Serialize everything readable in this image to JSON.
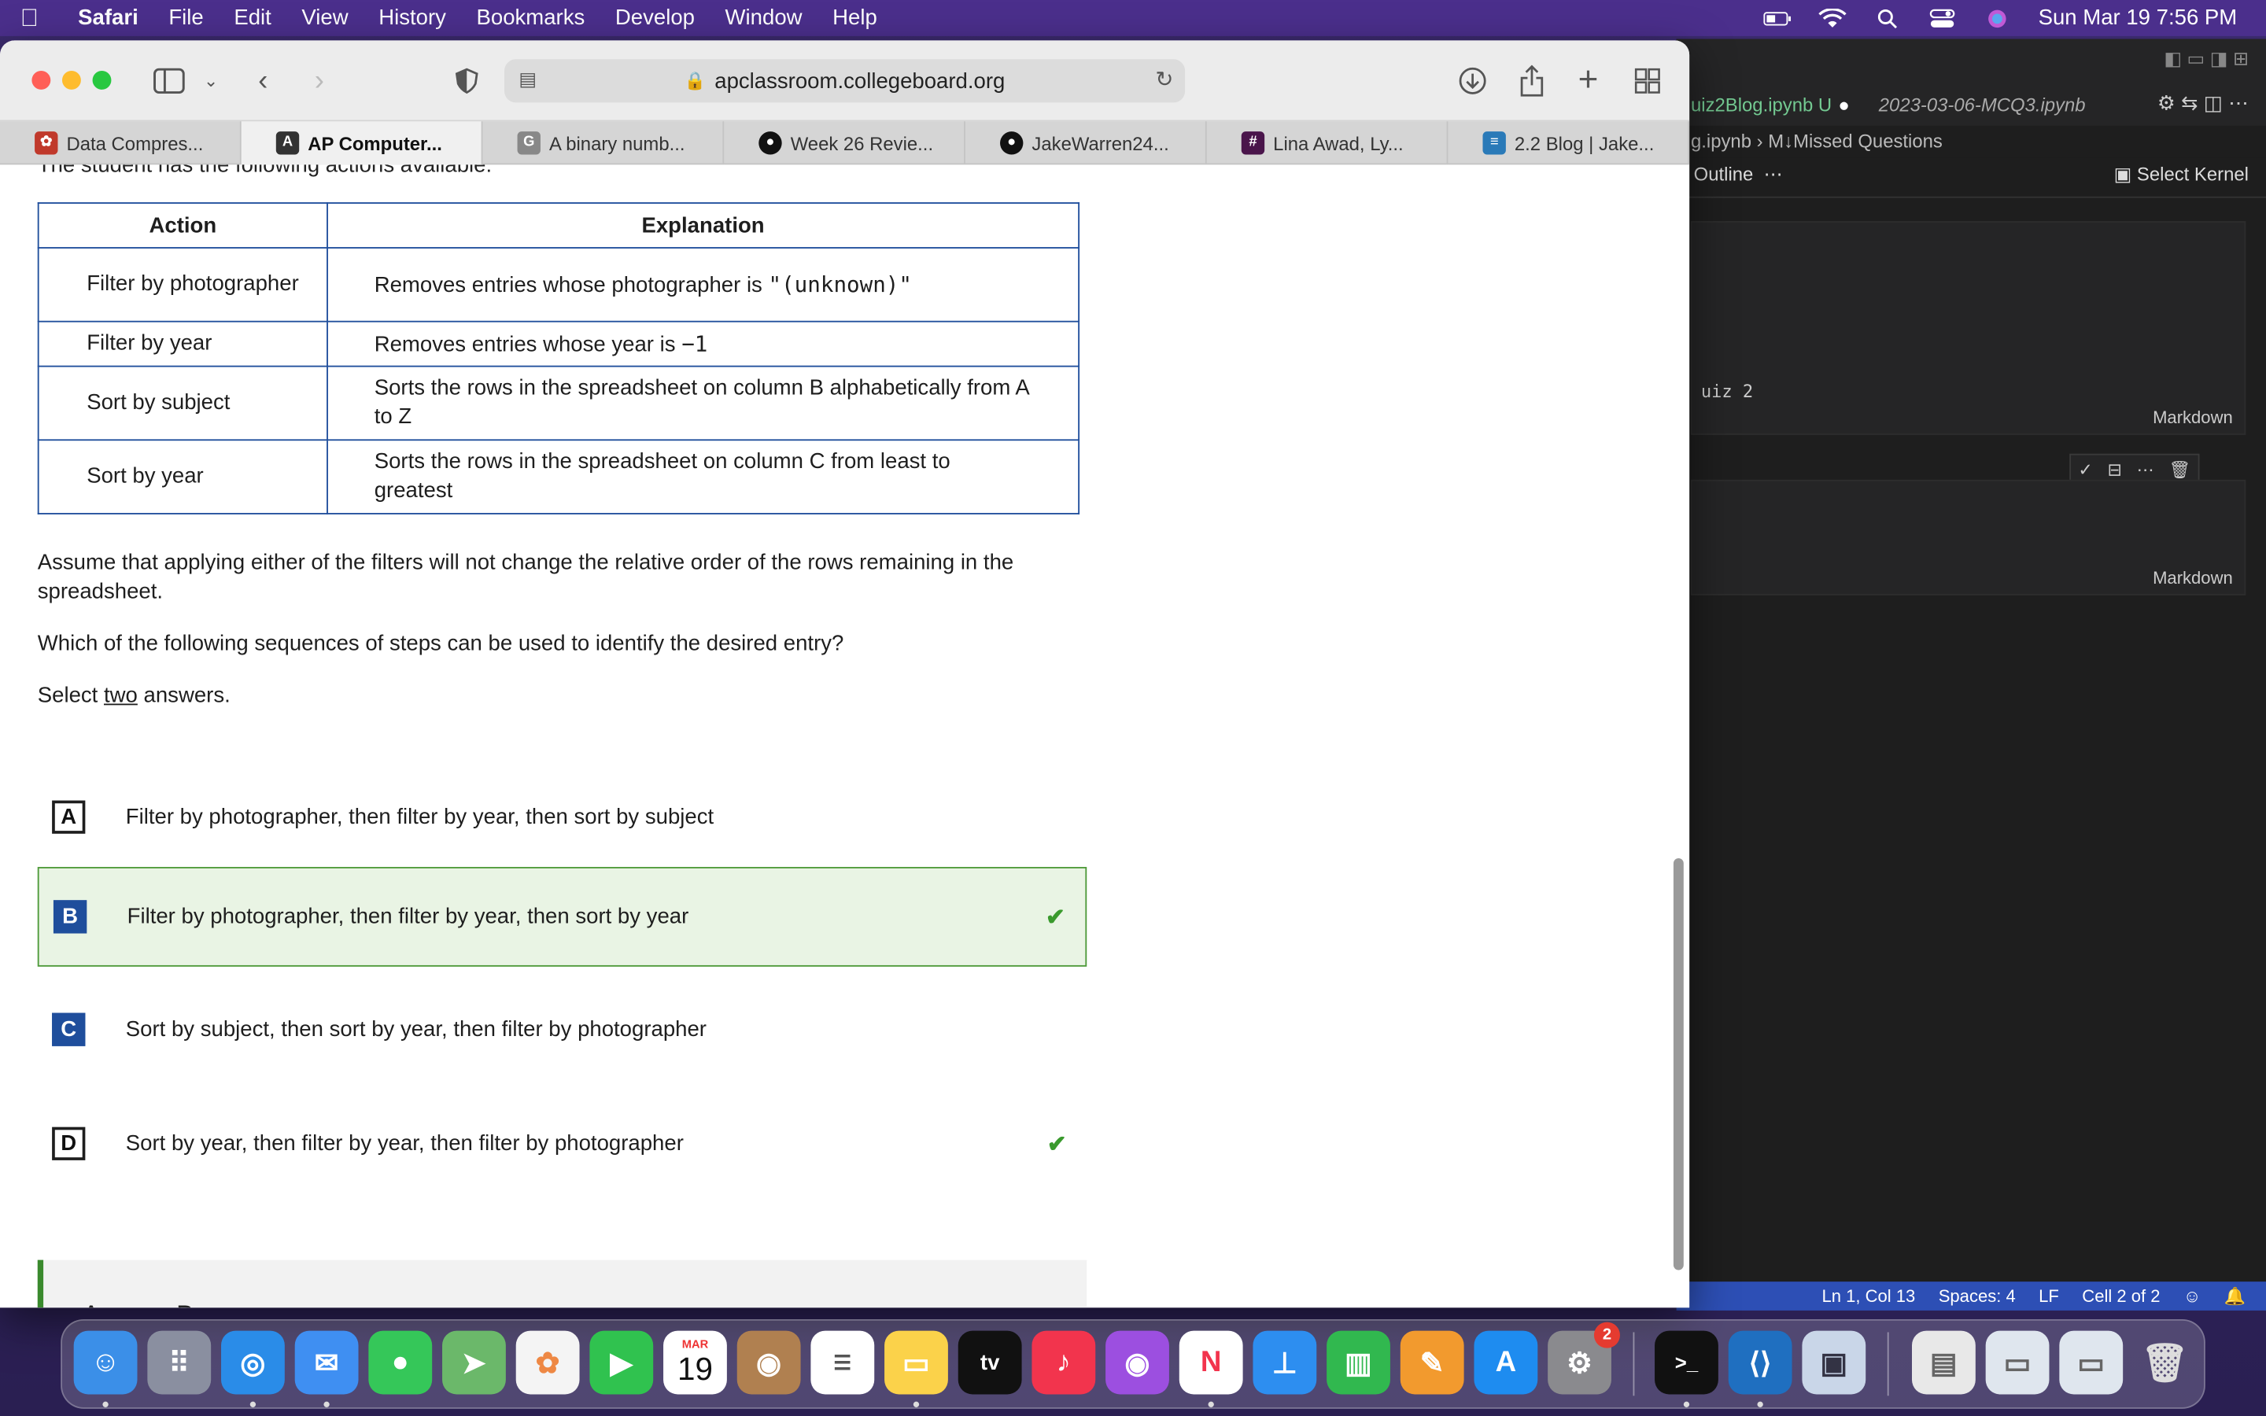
{
  "menubar": {
    "items": [
      "Safari",
      "File",
      "Edit",
      "View",
      "History",
      "Bookmarks",
      "Develop",
      "Window",
      "Help"
    ],
    "clock": "Sun Mar 19  7:56 PM"
  },
  "safari": {
    "url": "apclassroom.collegeboard.org",
    "tabs": [
      {
        "label": "Data Compres...",
        "icon": "app-icon",
        "color": "#c0392b"
      },
      {
        "label": "AP Computer...",
        "icon": "ap-icon",
        "color": "#333333"
      },
      {
        "label": "A binary numb...",
        "icon": "g-icon",
        "color": "#888888"
      },
      {
        "label": "Week 26 Revie...",
        "icon": "github-icon",
        "color": "#111111"
      },
      {
        "label": "JakeWarren24...",
        "icon": "github-icon",
        "color": "#111111"
      },
      {
        "label": "Lina Awad, Ly...",
        "icon": "slack-icon",
        "color": "#4a154b"
      },
      {
        "label": "2.2 Blog | Jake...",
        "icon": "blog-icon",
        "color": "#2a7ab8"
      }
    ]
  },
  "question": {
    "cut_text": "The student has the following actions available:",
    "table_headers": [
      "Action",
      "Explanation"
    ],
    "rows": [
      {
        "action": "Filter by photographer",
        "explanation_pre": "Removes entries whose photographer is ",
        "explanation_code": "\"(unknown)\"",
        "explanation_post": ""
      },
      {
        "action": "Filter by year",
        "explanation_pre": "Removes entries whose year is ",
        "explanation_code": "−1",
        "explanation_post": ""
      },
      {
        "action": "Sort by subject",
        "explanation_pre": "Sorts the rows in the spreadsheet on column B alphabetically from A to Z",
        "explanation_code": "",
        "explanation_post": ""
      },
      {
        "action": "Sort by year",
        "explanation_pre": "Sorts the rows in the spreadsheet on column C from least to greatest",
        "explanation_code": "",
        "explanation_post": ""
      }
    ],
    "para1": "Assume that applying either of the filters will not change the relative order of the rows remaining in the spreadsheet.",
    "para2": "Which of the following sequences of steps can be used to identify the desired entry?",
    "select_pre": "Select ",
    "select_u": "two",
    "select_post": " answers.",
    "options": [
      {
        "letter": "A",
        "text": "Filter by photographer, then filter by year, then sort by subject",
        "selected": false,
        "correct": false
      },
      {
        "letter": "B",
        "text": "Filter by photographer, then filter by year, then sort by year",
        "selected": true,
        "correct": true
      },
      {
        "letter": "C",
        "text": "Sort by subject, then sort by year, then filter by photographer",
        "selected": true,
        "correct": false
      },
      {
        "letter": "D",
        "text": "Sort by year, then filter by year, then filter by photographer",
        "selected": false,
        "correct": true
      }
    ],
    "answer_label": "Answer B"
  },
  "vscode": {
    "tab1": "uiz2Blog.ipynb  U",
    "tab2": "2023-03-06-MCQ3.ipynb",
    "breadcrumb_file": "g.ipynb",
    "breadcrumb_section": "M↓Missed Questions",
    "outline": "Outline",
    "select_kernel": "Select Kernel",
    "cell1_text": "uiz 2",
    "cell_type": "Markdown",
    "status": [
      "Ln 1, Col 13",
      "Spaces: 4",
      "LF",
      "Cell 2 of 2"
    ]
  },
  "dock": {
    "calendar_month": "MAR",
    "calendar_day": "19",
    "settings_badge": "2"
  }
}
